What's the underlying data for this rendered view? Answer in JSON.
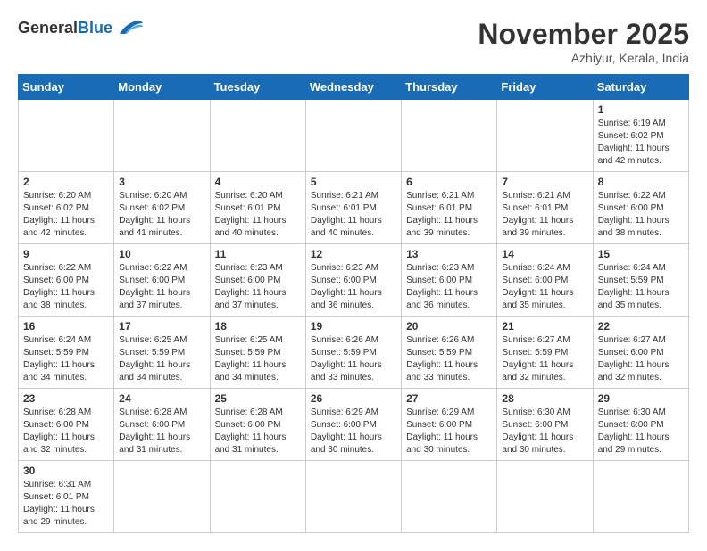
{
  "header": {
    "logo_general": "General",
    "logo_blue": "Blue",
    "month": "November 2025",
    "location": "Azhiyur, Kerala, India"
  },
  "weekdays": [
    "Sunday",
    "Monday",
    "Tuesday",
    "Wednesday",
    "Thursday",
    "Friday",
    "Saturday"
  ],
  "days": {
    "1": {
      "sunrise": "6:19 AM",
      "sunset": "6:02 PM",
      "daylight": "11 hours and 42 minutes."
    },
    "2": {
      "sunrise": "6:20 AM",
      "sunset": "6:02 PM",
      "daylight": "11 hours and 42 minutes."
    },
    "3": {
      "sunrise": "6:20 AM",
      "sunset": "6:02 PM",
      "daylight": "11 hours and 41 minutes."
    },
    "4": {
      "sunrise": "6:20 AM",
      "sunset": "6:01 PM",
      "daylight": "11 hours and 40 minutes."
    },
    "5": {
      "sunrise": "6:21 AM",
      "sunset": "6:01 PM",
      "daylight": "11 hours and 40 minutes."
    },
    "6": {
      "sunrise": "6:21 AM",
      "sunset": "6:01 PM",
      "daylight": "11 hours and 39 minutes."
    },
    "7": {
      "sunrise": "6:21 AM",
      "sunset": "6:01 PM",
      "daylight": "11 hours and 39 minutes."
    },
    "8": {
      "sunrise": "6:22 AM",
      "sunset": "6:00 PM",
      "daylight": "11 hours and 38 minutes."
    },
    "9": {
      "sunrise": "6:22 AM",
      "sunset": "6:00 PM",
      "daylight": "11 hours and 38 minutes."
    },
    "10": {
      "sunrise": "6:22 AM",
      "sunset": "6:00 PM",
      "daylight": "11 hours and 37 minutes."
    },
    "11": {
      "sunrise": "6:23 AM",
      "sunset": "6:00 PM",
      "daylight": "11 hours and 37 minutes."
    },
    "12": {
      "sunrise": "6:23 AM",
      "sunset": "6:00 PM",
      "daylight": "11 hours and 36 minutes."
    },
    "13": {
      "sunrise": "6:23 AM",
      "sunset": "6:00 PM",
      "daylight": "11 hours and 36 minutes."
    },
    "14": {
      "sunrise": "6:24 AM",
      "sunset": "6:00 PM",
      "daylight": "11 hours and 35 minutes."
    },
    "15": {
      "sunrise": "6:24 AM",
      "sunset": "5:59 PM",
      "daylight": "11 hours and 35 minutes."
    },
    "16": {
      "sunrise": "6:24 AM",
      "sunset": "5:59 PM",
      "daylight": "11 hours and 34 minutes."
    },
    "17": {
      "sunrise": "6:25 AM",
      "sunset": "5:59 PM",
      "daylight": "11 hours and 34 minutes."
    },
    "18": {
      "sunrise": "6:25 AM",
      "sunset": "5:59 PM",
      "daylight": "11 hours and 34 minutes."
    },
    "19": {
      "sunrise": "6:26 AM",
      "sunset": "5:59 PM",
      "daylight": "11 hours and 33 minutes."
    },
    "20": {
      "sunrise": "6:26 AM",
      "sunset": "5:59 PM",
      "daylight": "11 hours and 33 minutes."
    },
    "21": {
      "sunrise": "6:27 AM",
      "sunset": "5:59 PM",
      "daylight": "11 hours and 32 minutes."
    },
    "22": {
      "sunrise": "6:27 AM",
      "sunset": "6:00 PM",
      "daylight": "11 hours and 32 minutes."
    },
    "23": {
      "sunrise": "6:28 AM",
      "sunset": "6:00 PM",
      "daylight": "11 hours and 32 minutes."
    },
    "24": {
      "sunrise": "6:28 AM",
      "sunset": "6:00 PM",
      "daylight": "11 hours and 31 minutes."
    },
    "25": {
      "sunrise": "6:28 AM",
      "sunset": "6:00 PM",
      "daylight": "11 hours and 31 minutes."
    },
    "26": {
      "sunrise": "6:29 AM",
      "sunset": "6:00 PM",
      "daylight": "11 hours and 30 minutes."
    },
    "27": {
      "sunrise": "6:29 AM",
      "sunset": "6:00 PM",
      "daylight": "11 hours and 30 minutes."
    },
    "28": {
      "sunrise": "6:30 AM",
      "sunset": "6:00 PM",
      "daylight": "11 hours and 30 minutes."
    },
    "29": {
      "sunrise": "6:30 AM",
      "sunset": "6:00 PM",
      "daylight": "11 hours and 29 minutes."
    },
    "30": {
      "sunrise": "6:31 AM",
      "sunset": "6:01 PM",
      "daylight": "11 hours and 29 minutes."
    }
  }
}
